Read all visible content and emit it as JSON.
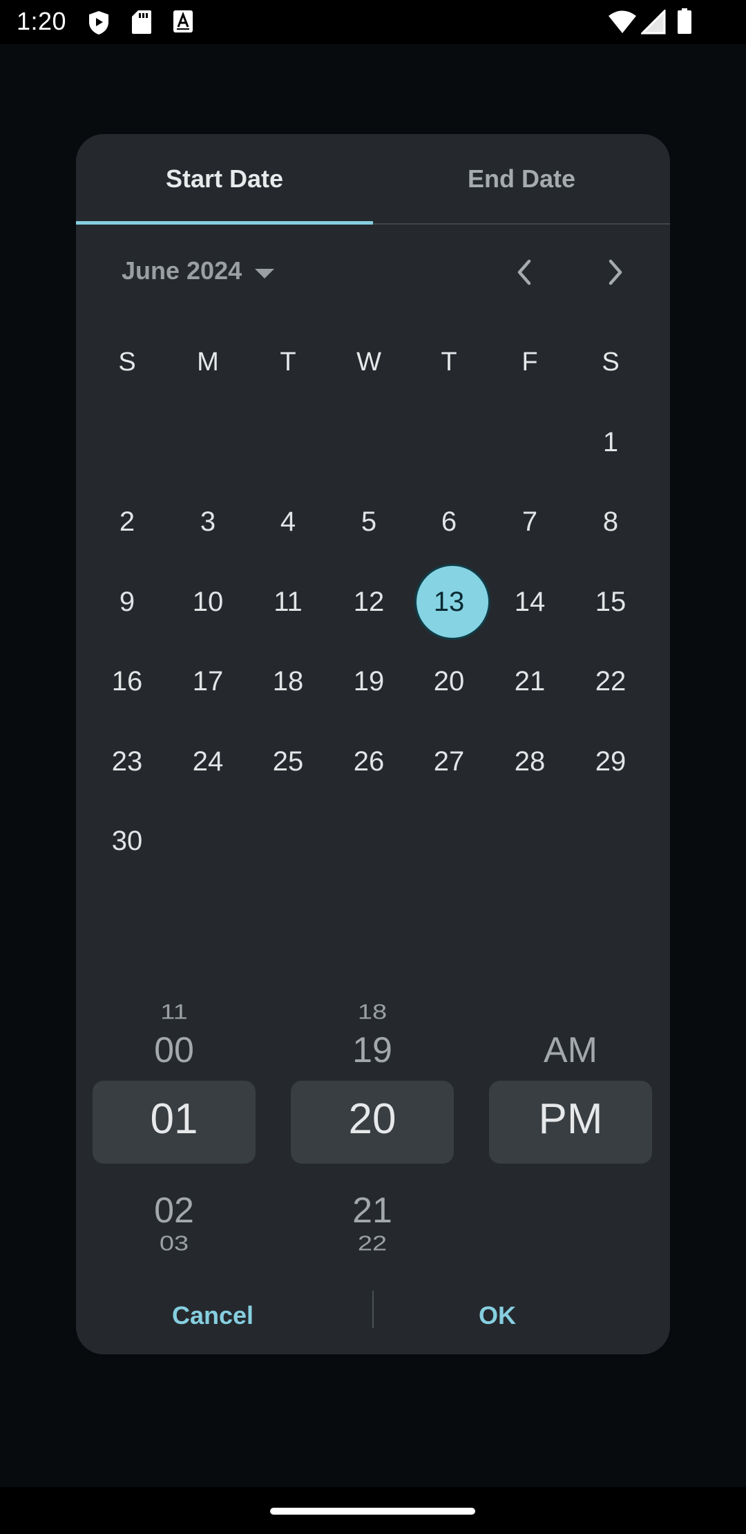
{
  "status_bar": {
    "time": "1:20",
    "left_icons": [
      "shield-play-icon",
      "sd-card-icon",
      "text-a-icon"
    ],
    "right_icons": [
      "wifi-icon",
      "signal-icon",
      "battery-icon"
    ]
  },
  "dialog": {
    "tabs": [
      {
        "label": "Start Date",
        "selected": true
      },
      {
        "label": "End Date",
        "selected": false
      }
    ],
    "month_label": "June 2024",
    "weekdays": [
      "S",
      "M",
      "T",
      "W",
      "T",
      "F",
      "S"
    ],
    "weeks": [
      [
        "",
        "",
        "",
        "",
        "",
        "",
        "1"
      ],
      [
        "2",
        "3",
        "4",
        "5",
        "6",
        "7",
        "8"
      ],
      [
        "9",
        "10",
        "11",
        "12",
        "13",
        "14",
        "15"
      ],
      [
        "16",
        "17",
        "18",
        "19",
        "20",
        "21",
        "22"
      ],
      [
        "23",
        "24",
        "25",
        "26",
        "27",
        "28",
        "29"
      ],
      [
        "30",
        "",
        "",
        "",
        "",
        "",
        ""
      ]
    ],
    "selected_day": "13",
    "time_picker": {
      "hour": {
        "items": [
          "11",
          "00",
          "01",
          "02",
          "03"
        ],
        "selected": "01"
      },
      "minute": {
        "items": [
          "18",
          "19",
          "20",
          "21",
          "22"
        ],
        "selected": "20"
      },
      "period": {
        "items": [
          "AM",
          "PM"
        ],
        "selected": "PM"
      }
    },
    "actions": {
      "cancel": "Cancel",
      "ok": "OK"
    }
  },
  "colors": {
    "accent": "#86cfe0",
    "surface": "#25292d",
    "background": "#080b0d"
  }
}
